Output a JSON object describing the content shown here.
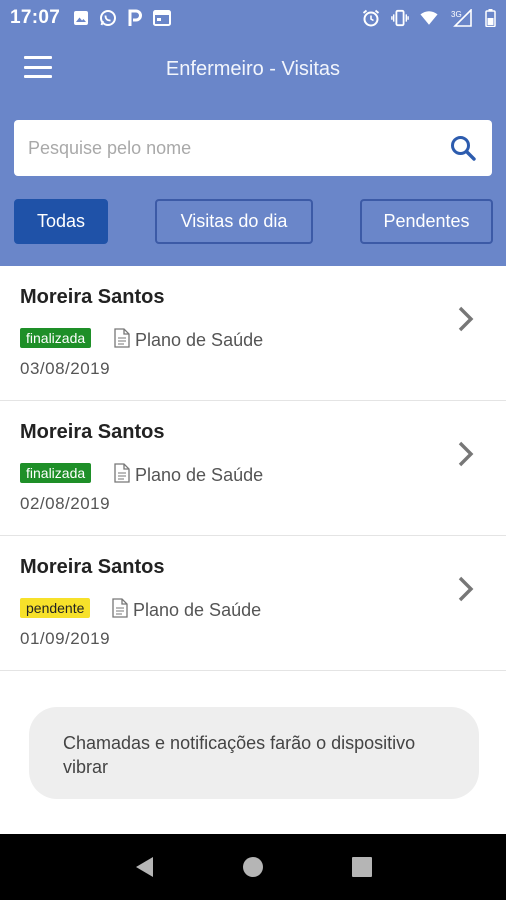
{
  "status_bar": {
    "time": "17:07",
    "network_label": "3G",
    "left_icons": [
      "image-icon",
      "whatsapp-icon",
      "p-app-icon",
      "calendar-icon"
    ],
    "right_icons": [
      "alarm-icon",
      "vibrate-icon",
      "wifi-icon",
      "signal-icon",
      "battery-icon"
    ]
  },
  "header": {
    "title": "Enfermeiro - Visitas"
  },
  "search": {
    "placeholder": "Pesquise pelo nome"
  },
  "filters": [
    {
      "label": "Todas",
      "active": true
    },
    {
      "label": "Visitas do dia",
      "active": false
    },
    {
      "label": "Pendentes",
      "active": false
    }
  ],
  "visits": [
    {
      "name": "Moreira Santos",
      "status": "finalizada",
      "plan": "Plano de Saúde",
      "date": "03/08/2019"
    },
    {
      "name": "Moreira Santos",
      "status": "finalizada",
      "plan": "Plano de Saúde",
      "date": "02/08/2019"
    },
    {
      "name": "Moreira Santos",
      "status": "pendente",
      "plan": "Plano de Saúde",
      "date": "01/09/2019"
    }
  ],
  "toast": {
    "message": "Chamadas e notificações farão o dispositivo vibrar"
  },
  "colors": {
    "primary": "#6a86c9",
    "active_filter": "#1f52a8",
    "finalizada": "#1e8f28",
    "pendente": "#f7e12a"
  }
}
